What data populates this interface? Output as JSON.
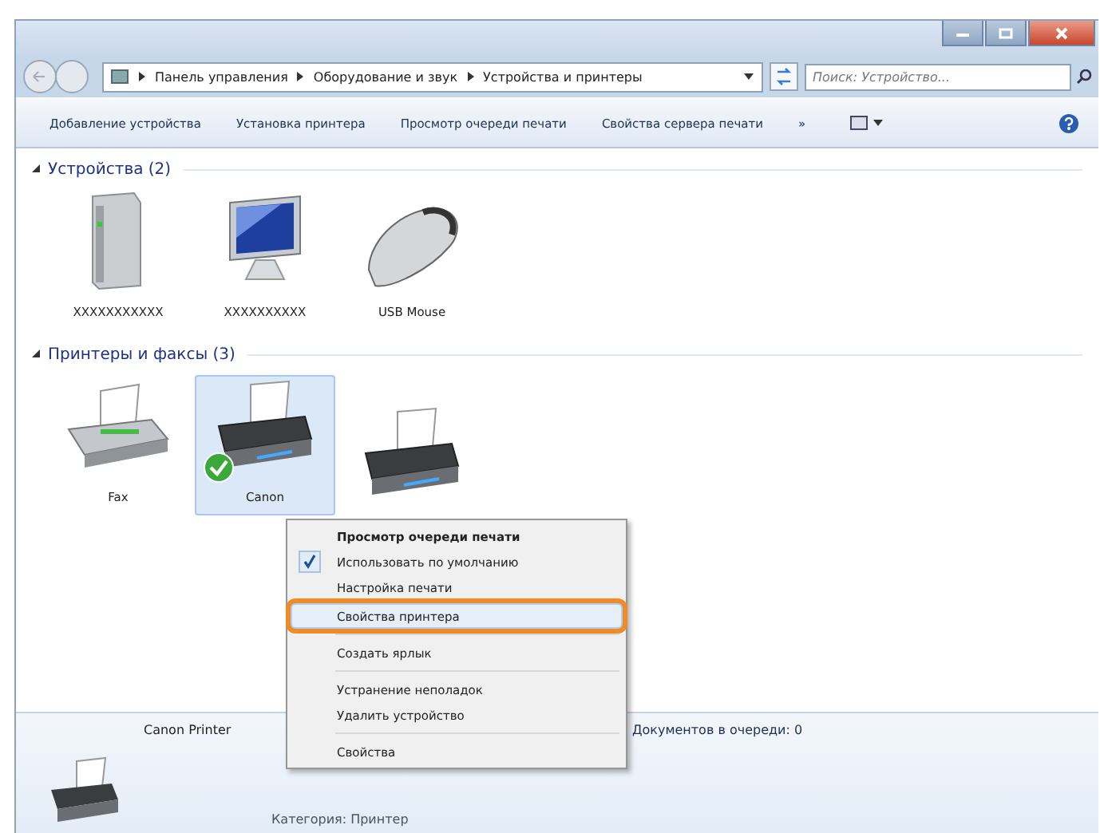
{
  "address": {
    "breadcrumbs": [
      "Панель управления",
      "Оборудование и звук",
      "Устройства и принтеры"
    ]
  },
  "search": {
    "placeholder": "Поиск: Устройство..."
  },
  "toolbar": {
    "buttons": [
      "Добавление устройства",
      "Установка принтера",
      "Просмотр очереди печати",
      "Свойства сервера печати"
    ],
    "overflow": "»"
  },
  "groups": [
    {
      "title": "Устройства (2)",
      "items": [
        {
          "kind": "drive",
          "label": "XXXXXXXXXXX",
          "selected": false,
          "default": false
        },
        {
          "kind": "monitor",
          "label": "XXXXXXXXXX",
          "selected": false,
          "default": false
        },
        {
          "kind": "mouse",
          "label": "USB Mouse",
          "selected": false,
          "default": false
        }
      ]
    },
    {
      "title": "Принтеры и факсы (3)",
      "items": [
        {
          "kind": "fax",
          "label": "Fax",
          "selected": false,
          "default": false
        },
        {
          "kind": "printer",
          "label": "Canon",
          "selected": true,
          "default": true
        },
        {
          "kind": "printer",
          "selected": false,
          "default": false
        }
      ]
    }
  ],
  "context_menu": [
    {
      "kind": "item",
      "label": "Просмотр очереди печати",
      "bold": true,
      "checked": false,
      "selected": false
    },
    {
      "kind": "item",
      "label": "Использовать по умолчанию",
      "bold": false,
      "checked": true,
      "selected": false
    },
    {
      "kind": "item",
      "label": "Настройка печати",
      "bold": false,
      "checked": false,
      "selected": false
    },
    {
      "kind": "item",
      "label": "Свойства принтера",
      "bold": false,
      "checked": false,
      "selected": true
    },
    {
      "kind": "separator"
    },
    {
      "kind": "item",
      "label": "Создать ярлык",
      "bold": false,
      "checked": false,
      "selected": false
    },
    {
      "kind": "separator"
    },
    {
      "kind": "item",
      "label": "Устранение неполадок",
      "bold": false,
      "checked": false,
      "selected": false
    },
    {
      "kind": "item",
      "label": "Удалить устройство",
      "bold": false,
      "checked": false,
      "selected": false
    },
    {
      "kind": "separator"
    },
    {
      "kind": "item",
      "label": "Свойства",
      "bold": false,
      "checked": false,
      "selected": false
    }
  ],
  "details": {
    "name": "Canon Printer",
    "status": "Документов в очереди: 0",
    "category": "Категория: Принтер"
  }
}
